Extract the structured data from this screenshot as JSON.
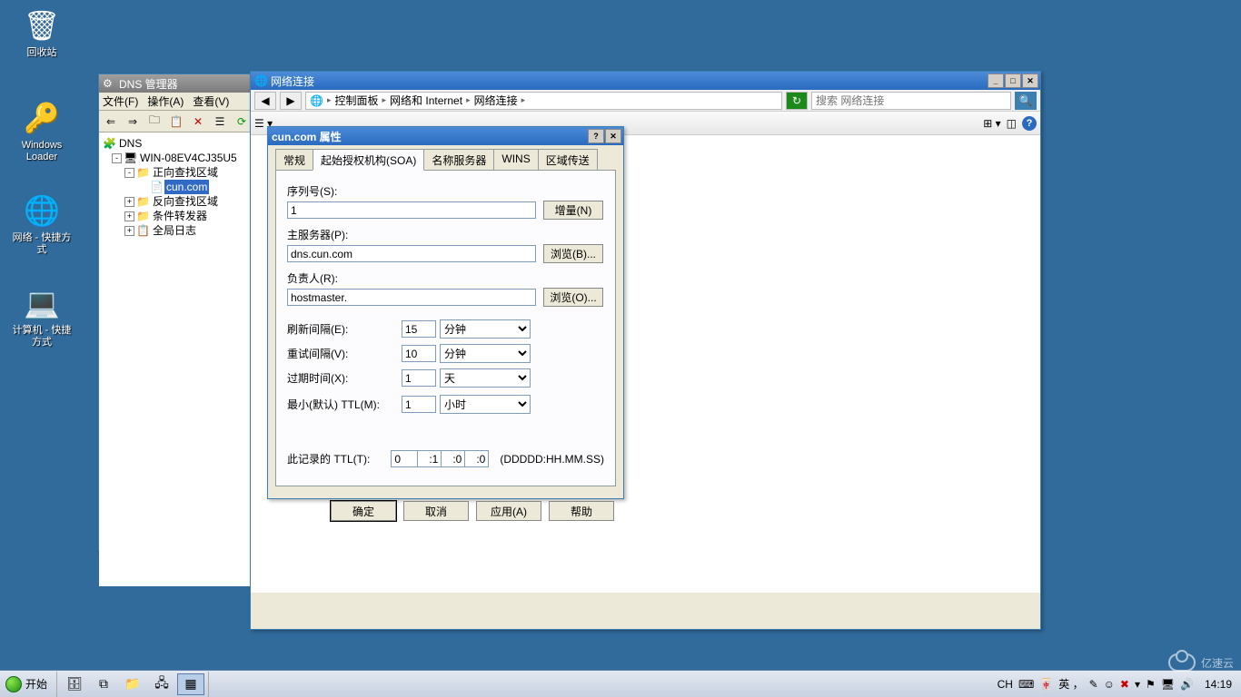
{
  "desktop": {
    "icons": [
      {
        "label": "回收站",
        "icon": "🗑"
      },
      {
        "label": "Windows Loader",
        "icon": "🔑"
      },
      {
        "label": "网络 - 快捷方式",
        "icon": "🌐"
      },
      {
        "label": "计算机 - 快捷方式",
        "icon": "💻"
      }
    ]
  },
  "dnsmgr": {
    "title": "DNS 管理器",
    "menus": [
      "文件(F)",
      "操作(A)",
      "查看(V)"
    ],
    "tree": {
      "root": "DNS",
      "server": "WIN-08EV4CJ35U5",
      "fwdzone": "正向查找区域",
      "domain": "cun.com",
      "revzone": "反向查找区域",
      "forwarders": "条件转发器",
      "globallog": "全局日志"
    }
  },
  "netconn": {
    "title": "网络连接",
    "breadcrumb": [
      "控制面板",
      "网络和 Internet",
      "网络连接"
    ],
    "search_placeholder": "搜索 网络连接"
  },
  "props": {
    "title": "cun.com 属性",
    "tabs": [
      "常规",
      "起始授权机构(SOA)",
      "名称服务器",
      "WINS",
      "区域传送"
    ],
    "activeTab": 1,
    "labels": {
      "serial": "序列号(S):",
      "increment": "增量(N)",
      "primary": "主服务器(P):",
      "browseB": "浏览(B)...",
      "responsible": "负责人(R):",
      "browseO": "浏览(O)...",
      "refresh": "刷新间隔(E):",
      "retry": "重试间隔(V):",
      "expire": "过期时间(X):",
      "minttl": "最小(默认) TTL(M):",
      "recordttl": "此记录的 TTL(T):",
      "ttlformat": "(DDDDD:HH.MM.SS)"
    },
    "values": {
      "serial": "1",
      "primary": "dns.cun.com",
      "responsible": "hostmaster.",
      "refresh": "15",
      "refresh_unit": "分钟",
      "retry": "10",
      "retry_unit": "分钟",
      "expire": "1",
      "expire_unit": "天",
      "minttl": "1",
      "minttl_unit": "小时",
      "ttl_d": "0",
      "ttl_h": ":1",
      "ttl_m": ":0",
      "ttl_s": ":0"
    },
    "units": [
      "分钟",
      "小时",
      "天"
    ],
    "buttons": {
      "ok": "确定",
      "cancel": "取消",
      "apply": "应用(A)",
      "help": "帮助"
    }
  },
  "taskbar": {
    "start": "开始",
    "ime": {
      "ch": "CH",
      "pad": "⌨",
      "zh": "中",
      "comma": "英 ，",
      "smile": "☺"
    },
    "clock": "14:19"
  },
  "watermark": "亿速云"
}
